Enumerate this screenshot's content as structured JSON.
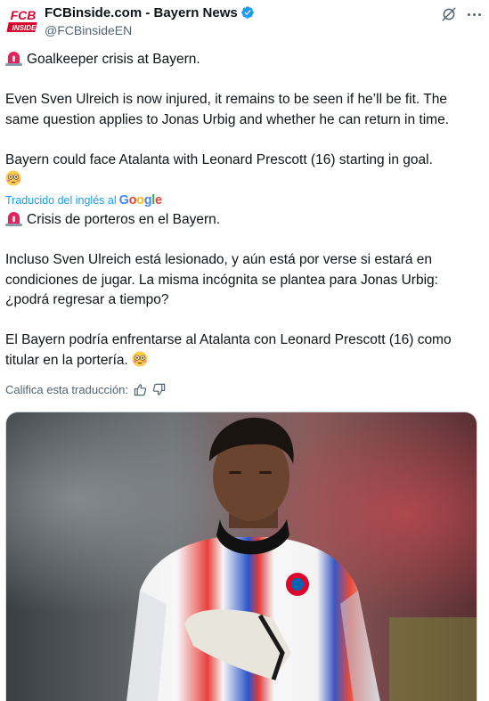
{
  "author": {
    "name": "FCBinside.com - Bayern News",
    "handle": "@FCBinsideEN",
    "avatar_text_top": "FCB",
    "avatar_text_bottom": "INSIDE",
    "verified_icon": "verified-badge-icon"
  },
  "actions": {
    "grok_icon": "grok-icon",
    "more_icon": "more-icon"
  },
  "tweet": {
    "line1": "Goalkeeper crisis at Bayern.",
    "paragraph2": "Even Sven Ulreich is now injured, it remains to be seen if he’ll be fit. The same question applies to Jonas Urbig and whether he can return in time.",
    "paragraph3": "Bayern could face Atalanta with Leonard Prescott (16) starting in goal."
  },
  "translation": {
    "note": "Traducido del inglés al",
    "provider": "Google",
    "line1": "Crisis de porteros en el Bayern.",
    "paragraph2": "Incluso Sven Ulreich está lesionado, y aún está por verse si estará en condiciones de jugar. La misma incógnita se plantea para Jonas Urbig: ¿podrá regresar a tiempo?",
    "paragraph3": "El Bayern podría enfrentarse al Atalanta con Leonard Prescott (16) como titular en la portería."
  },
  "rate": {
    "label": "Califica esta traducción:"
  },
  "colors": {
    "accent": "#1d9bf0",
    "text": "#0f1419",
    "secondary": "#536471",
    "siren_red": "#e0245e"
  }
}
